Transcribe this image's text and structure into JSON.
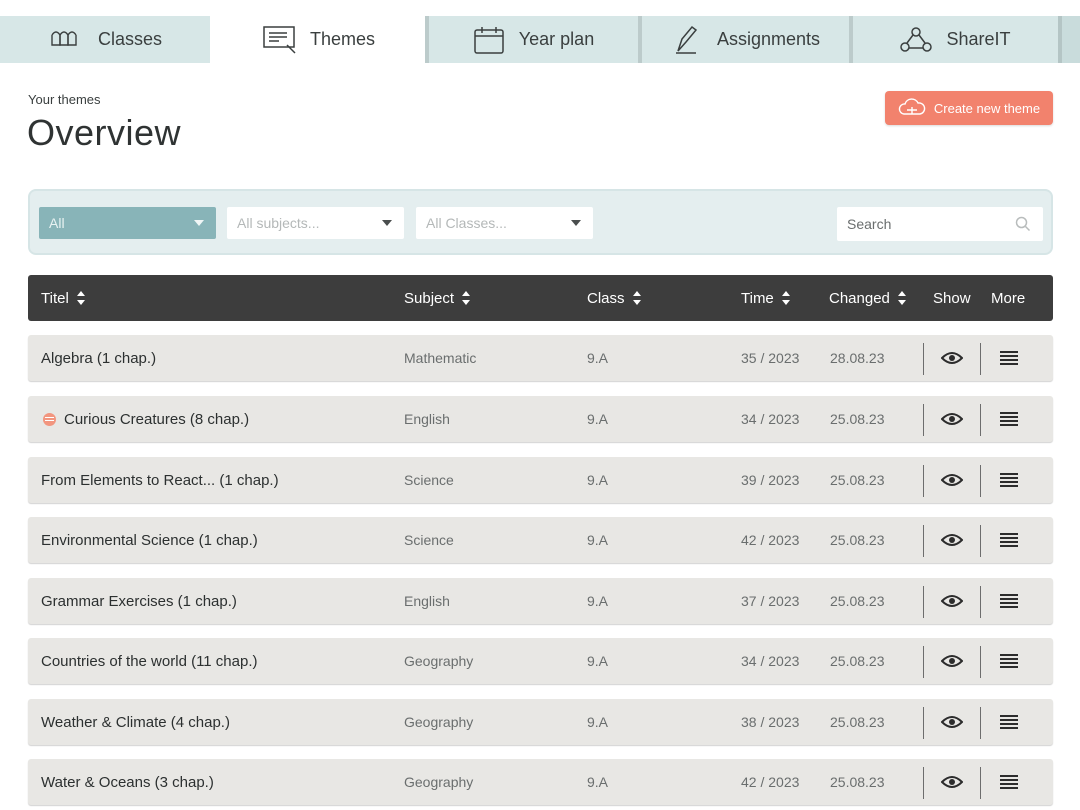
{
  "tabs": [
    {
      "label": "Classes",
      "icon": "classes-icon"
    },
    {
      "label": "Themes",
      "icon": "themes-icon",
      "active": true
    },
    {
      "label": "Year plan",
      "icon": "calendar-icon"
    },
    {
      "label": "Assignments",
      "icon": "pen-icon"
    },
    {
      "label": "ShareIT",
      "icon": "share-network-icon"
    }
  ],
  "header": {
    "breadcrumb": "Your themes",
    "title": "Overview",
    "create_button": "Create new theme"
  },
  "filters": {
    "type_selected": "All",
    "subject_selected": "All subjects...",
    "class_selected": "All Classes...",
    "search_placeholder": "Search"
  },
  "table": {
    "columns": {
      "title": "Titel",
      "subject": "Subject",
      "class": "Class",
      "time": "Time",
      "changed": "Changed",
      "show": "Show",
      "more": "More"
    },
    "rows": [
      {
        "title": "Algebra (1 chap.)",
        "subject": "Mathematic",
        "class": "9.A",
        "time": "35 / 2023",
        "changed": "28.08.23",
        "flag": false
      },
      {
        "title": "Curious Creatures (8 chap.)",
        "subject": "English",
        "class": "9.A",
        "time": "34 / 2023",
        "changed": "25.08.23",
        "flag": true
      },
      {
        "title": "From Elements to React... (1 chap.)",
        "subject": "Science",
        "class": "9.A",
        "time": "39 / 2023",
        "changed": "25.08.23",
        "flag": false
      },
      {
        "title": "Environmental Science (1 chap.)",
        "subject": "Science",
        "class": "9.A",
        "time": "42 / 2023",
        "changed": "25.08.23",
        "flag": false
      },
      {
        "title": "Grammar Exercises (1 chap.)",
        "subject": "English",
        "class": "9.A",
        "time": "37 / 2023",
        "changed": "25.08.23",
        "flag": false
      },
      {
        "title": "Countries of the world (11 chap.)",
        "subject": "Geography",
        "class": "9.A",
        "time": "34 / 2023",
        "changed": "25.08.23",
        "flag": false
      },
      {
        "title": "Weather & Climate (4 chap.)",
        "subject": "Geography",
        "class": "9.A",
        "time": "38 / 2023",
        "changed": "25.08.23",
        "flag": false
      },
      {
        "title": "Water & Oceans (3 chap.)",
        "subject": "Geography",
        "class": "9.A",
        "time": "42 / 2023",
        "changed": "25.08.23",
        "flag": false
      }
    ]
  },
  "colors": {
    "accent": "#f2826d",
    "tab_bg": "#d7e7e7",
    "filter_active": "#88b4b8",
    "table_header": "#3d3d3d",
    "row_bg": "#e8e7e4"
  }
}
